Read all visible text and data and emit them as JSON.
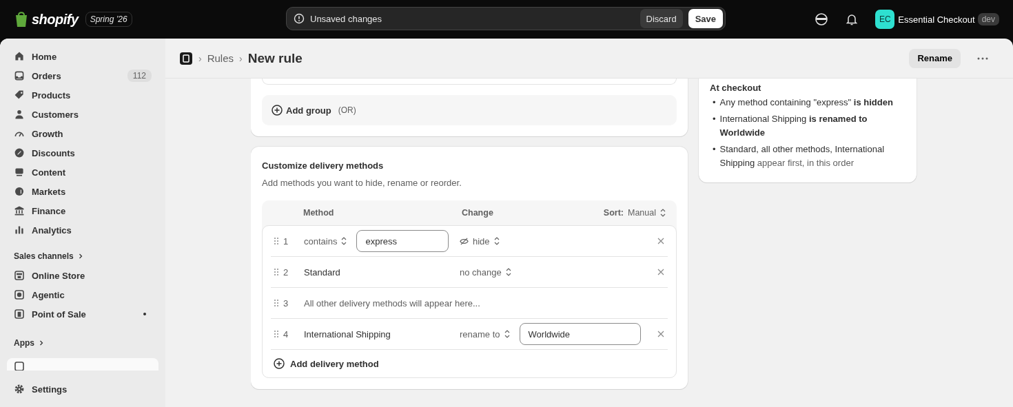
{
  "topbar": {
    "logo": "shopify",
    "edition": "Spring ’26",
    "unsaved": {
      "message": "Unsaved changes",
      "discard": "Discard",
      "save": "Save"
    },
    "account": {
      "initials": "EC",
      "name": "Essential Checkout",
      "tag": "dev"
    }
  },
  "sidebar": {
    "items": [
      {
        "label": "Home",
        "selected": false
      },
      {
        "label": "Orders",
        "badge": "112",
        "selected": false
      },
      {
        "label": "Products",
        "selected": false
      },
      {
        "label": "Customers",
        "selected": false
      },
      {
        "label": "Growth",
        "selected": false
      },
      {
        "label": "Discounts",
        "selected": false
      },
      {
        "label": "Content",
        "selected": false
      },
      {
        "label": "Markets",
        "selected": false
      },
      {
        "label": "Finance",
        "selected": false
      },
      {
        "label": "Analytics",
        "selected": false
      }
    ],
    "sales_channels": {
      "title": "Sales channels",
      "items": [
        {
          "label": "Online Store",
          "notification": false,
          "selected": false
        },
        {
          "label": "Agentic",
          "notification": false,
          "selected": false
        },
        {
          "label": "Point of Sale",
          "notification": true,
          "selected": false
        }
      ]
    },
    "apps": {
      "title": "Apps",
      "items": [
        {
          "selected": true
        }
      ]
    },
    "settings": "Settings"
  },
  "page": {
    "breadcrumb": [
      {
        "separator": "›",
        "label": "Rules"
      }
    ],
    "title_separator": "›",
    "title": "New rule",
    "rename": "Rename"
  },
  "conditions_card": {
    "add_group": "Add group",
    "add_group_hint": "(OR)"
  },
  "delivery_card": {
    "title": "Customize delivery methods",
    "description": "Add methods you want to hide, rename or reorder.",
    "columns": [
      "Method",
      "Change"
    ],
    "sort": {
      "label": "Sort:",
      "value": "Manual"
    },
    "rows": [
      {
        "kind": "hidden_match",
        "number": "1",
        "operator": "contains",
        "value": "express",
        "change": "hide"
      },
      {
        "kind": "method",
        "number": "2",
        "name": "Standard",
        "change": "no change"
      },
      {
        "kind": "placeholder",
        "number": "3",
        "text": "All other delivery methods will appear here..."
      },
      {
        "kind": "renamed_method",
        "number": "4",
        "name": "International Shipping",
        "change": "rename to",
        "rename_value": "Worldwide"
      }
    ],
    "add_method": "Add delivery method"
  },
  "summary": {
    "title": "At checkout",
    "items": [
      {
        "marker": "•",
        "text": "Any method containing \"express\" **is hidden**"
      },
      {
        "marker": "•",
        "text": "International Shipping **is renamed to Worldwide**"
      },
      {
        "marker": "•",
        "text": "Standard, all other methods, International Shipping",
        "note": "appear first, in this order"
      }
    ]
  }
}
